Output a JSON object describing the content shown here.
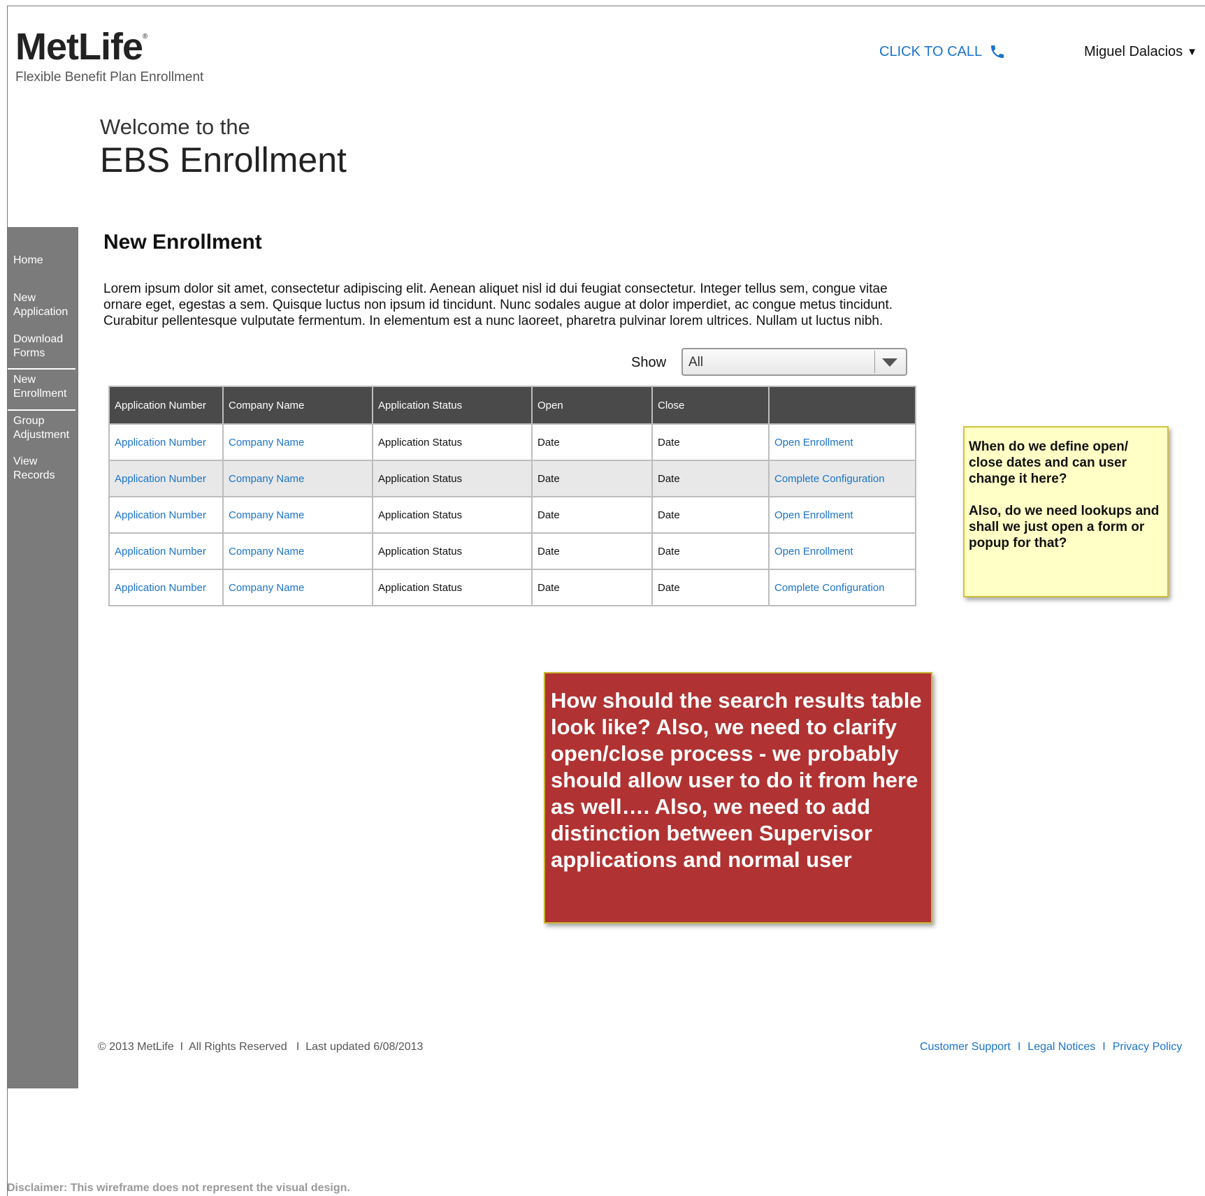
{
  "header": {
    "logo": "MetLife",
    "logo_mark": "®",
    "tagline": "Flexible Benefit Plan Enrollment",
    "click_to_call": "CLICK TO CALL",
    "user_name": "Miguel Dalacios"
  },
  "welcome": {
    "line1": "Welcome to the",
    "line2": "EBS Enrollment"
  },
  "sidebar": {
    "items": [
      {
        "label": "Home"
      },
      {
        "label": "New Application"
      },
      {
        "label": "Download Forms"
      },
      {
        "label": "New Enrollment"
      },
      {
        "label": "Group Adjustment"
      },
      {
        "label": "View Records"
      }
    ]
  },
  "main": {
    "title": "New Enrollment",
    "intro": "Lorem ipsum dolor sit amet, consectetur adipiscing elit. Aenean aliquet nisl id dui feugiat consectetur. Integer tellus sem, congue vitae ornare eget, egestas a sem. Quisque luctus non ipsum id tincidunt. Nunc sodales augue at dolor imperdiet, ac congue metus tincidunt. Curabitur pellentesque vulputate fermentum. In elementum est a nunc laoreet, pharetra pulvinar lorem ultrices. Nullam ut luctus nibh.",
    "show_label": "Show",
    "show_value": "All",
    "table": {
      "headers": [
        "Application Number",
        "Company Name",
        "Application Status",
        "Open",
        "Close",
        ""
      ],
      "rows": [
        [
          "Application Number",
          "Company Name",
          "Application Status",
          "Date",
          "Date",
          "Open Enrollment"
        ],
        [
          "Application Number",
          "Company Name",
          "Application Status",
          "Date",
          "Date",
          "Complete Configuration"
        ],
        [
          "Application Number",
          "Company Name",
          "Application Status",
          "Date",
          "Date",
          "Open Enrollment"
        ],
        [
          "Application Number",
          "Company Name",
          "Application Status",
          "Date",
          "Date",
          "Open Enrollment"
        ],
        [
          "Application Number",
          "Company Name",
          "Application Status",
          "Date",
          "Date",
          "Complete Configuration"
        ]
      ]
    }
  },
  "notes": {
    "yellow_1": "When do we define open/ close dates and can user change it here?",
    "yellow_2": "Also, do we need lookups and shall we just open a form or popup for that?",
    "red": "How should the search results table look like? Also, we need to clarify open/close process - we probably should allow user to do it from here as well…. Also, we need to add distinction between Supervisor applications and normal user"
  },
  "footer": {
    "copyright": "© 2013 MetLife  I  All Rights Reserved   I  Last updated 6/08/2013",
    "links": [
      "Customer Support",
      "Legal Notices",
      "Privacy Policy"
    ],
    "separator": "I",
    "disclaimer": "Disclaimer: This wireframe does not represent the visual design."
  },
  "colors": {
    "link": "#1a73c9",
    "sidebar": "#7b7b7b",
    "table_header": "#4a4a4a",
    "note_yellow": "#ffffc6",
    "note_red": "#b03232"
  },
  "icons": {
    "phone": "phone-icon",
    "dropdown": "chevron-down-icon",
    "user_caret": "caret-down-icon"
  }
}
